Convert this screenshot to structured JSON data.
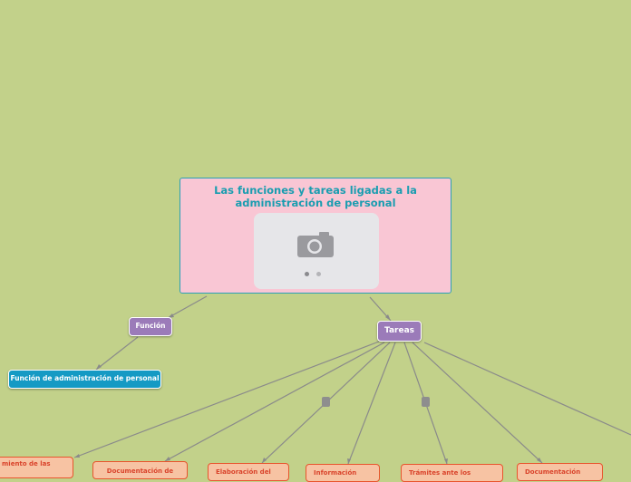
{
  "central_topic": {
    "title": "Las funciones y tareas ligadas a la administración de personal",
    "image_icon": "camera-icon"
  },
  "nodes": {
    "funcion": "Función",
    "funcion_admin": "Función de administración de personal",
    "tareas": "Tareas"
  },
  "tareas_children": [
    "miento de las",
    "Documentación de",
    "Elaboración del",
    "Información",
    "Trámites ante los",
    "Documentación"
  ],
  "colors": {
    "background": "#c2d18a",
    "central_fill": "#f9c6d4",
    "central_border": "#2aa0b6",
    "purple_node": "#9b7bb9",
    "blue_node": "#159ac4",
    "orange_fill": "#f7c3a3",
    "orange_border": "#e8542c",
    "connector": "#8a8a8a"
  }
}
